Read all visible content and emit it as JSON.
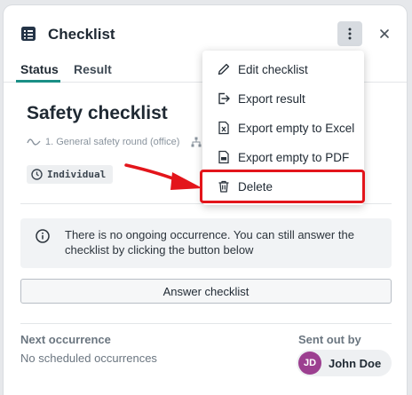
{
  "header": {
    "title": "Checklist",
    "title_icon": "list-icon",
    "more_icon": "more-vertical-icon",
    "close_icon": "close-icon"
  },
  "tabs": [
    {
      "label": "Status",
      "active": true
    },
    {
      "label": "Result",
      "active": false
    }
  ],
  "checklist": {
    "title": "Safety checklist",
    "round": "1. General safety round (office)",
    "badge": "Individual"
  },
  "info": {
    "message": "There is no ongoing occurrence. You can still answer the checklist by clicking the button below"
  },
  "answer_button": "Answer checklist",
  "next_occurrence": {
    "label": "Next occurrence",
    "value": "No scheduled occurrences"
  },
  "sent_out_by": {
    "label": "Sent out by",
    "initials": "JD",
    "name": "John Doe"
  },
  "menu": {
    "items": [
      {
        "label": "Edit checklist",
        "icon": "pencil-icon"
      },
      {
        "label": "Export result",
        "icon": "export-icon"
      },
      {
        "label": "Export empty to Excel",
        "icon": "excel-file-icon"
      },
      {
        "label": "Export empty to PDF",
        "icon": "pdf-file-icon"
      },
      {
        "label": "Delete",
        "icon": "trash-icon"
      }
    ]
  },
  "colors": {
    "accent": "#1a8f86",
    "highlight": "#e3151b",
    "avatar": "#9c3f90"
  }
}
